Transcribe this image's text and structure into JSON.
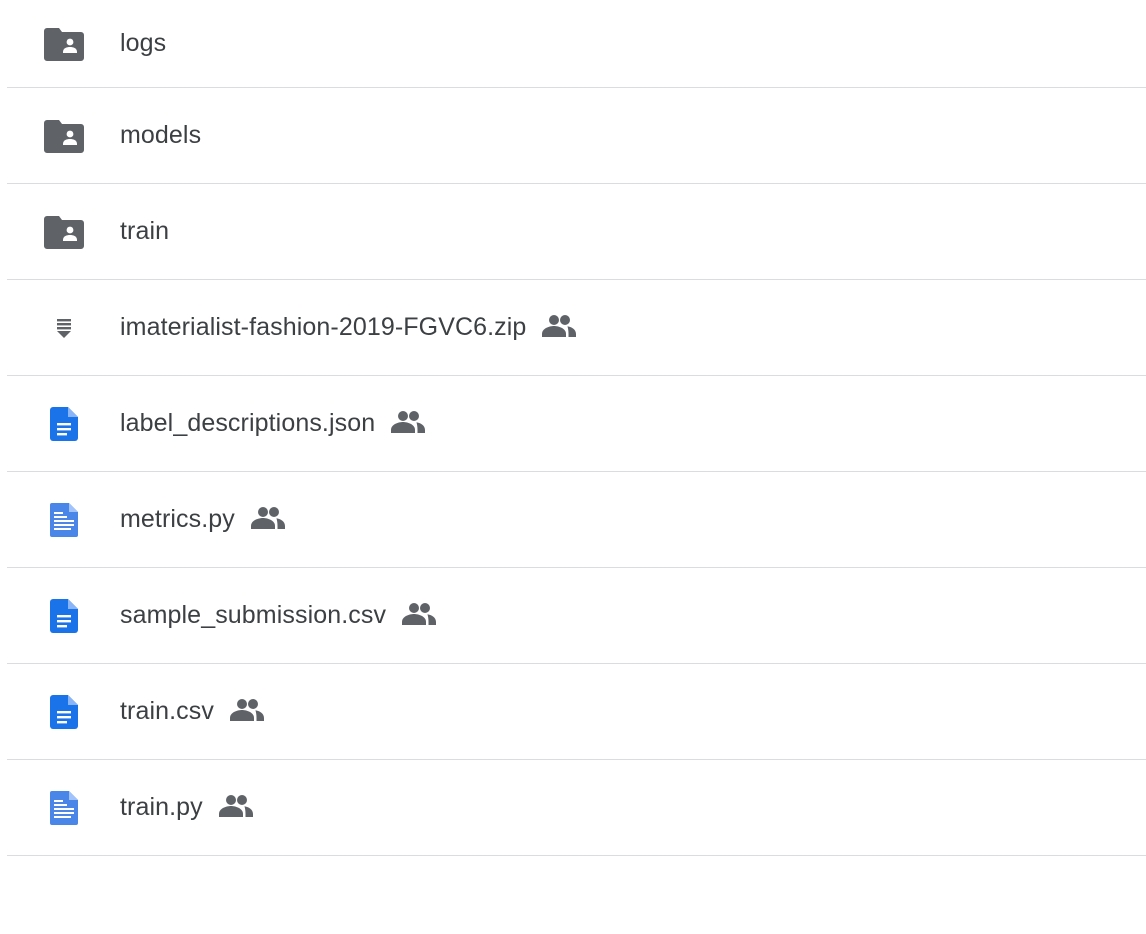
{
  "files": [
    {
      "name": "logs",
      "type": "shared-folder",
      "icon": "shared-folder-icon",
      "shared": false
    },
    {
      "name": "models",
      "type": "shared-folder",
      "icon": "shared-folder-icon",
      "shared": false
    },
    {
      "name": "train",
      "type": "shared-folder",
      "icon": "shared-folder-icon",
      "shared": false
    },
    {
      "name": "imaterialist-fashion-2019-FGVC6.zip",
      "type": "zip",
      "icon": "zip-file-icon",
      "shared": true
    },
    {
      "name": "label_descriptions.json",
      "type": "doc",
      "icon": "document-icon",
      "shared": true
    },
    {
      "name": "metrics.py",
      "type": "text",
      "icon": "text-file-icon",
      "shared": true
    },
    {
      "name": "sample_submission.csv",
      "type": "doc",
      "icon": "document-icon",
      "shared": true
    },
    {
      "name": "train.csv",
      "type": "doc",
      "icon": "document-icon",
      "shared": true
    },
    {
      "name": "train.py",
      "type": "text",
      "icon": "text-file-icon",
      "shared": true
    }
  ],
  "colors": {
    "folder": "#5f6368",
    "doc": "#1a73e8",
    "text": "#4a86e8",
    "shared_icon": "#5f6368",
    "divider": "#dadce0",
    "text_color": "#3c4043"
  }
}
